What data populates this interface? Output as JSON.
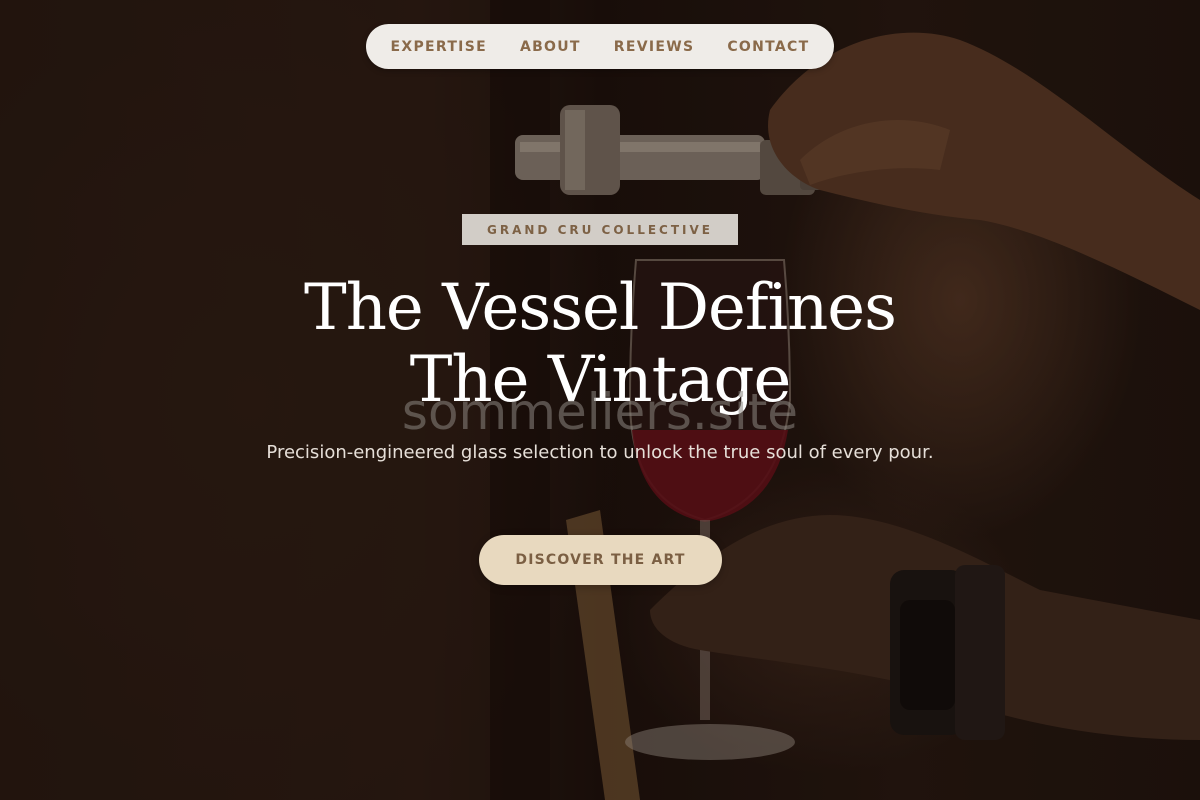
{
  "nav": {
    "items": [
      {
        "label": "EXPERTISE"
      },
      {
        "label": "ABOUT"
      },
      {
        "label": "REVIEWS"
      },
      {
        "label": "CONTACT"
      }
    ]
  },
  "hero": {
    "badge": "GRAND CRU COLLECTIVE",
    "headline_line1": "The Vessel Defines",
    "headline_line2": "The Vintage",
    "watermark": "sommeliers.site",
    "subtitle": "Precision-engineered glass selection to unlock the true soul of every pour.",
    "cta_label": "DISCOVER THE ART"
  },
  "colors": {
    "background": "#1d120d",
    "nav_background": "#efece8",
    "nav_text": "#8a6a4a",
    "badge_background": "#d2cdc7",
    "cta_background": "#e8d9bf",
    "cta_text": "#7b5f43",
    "wine": "#6b0f1a"
  }
}
